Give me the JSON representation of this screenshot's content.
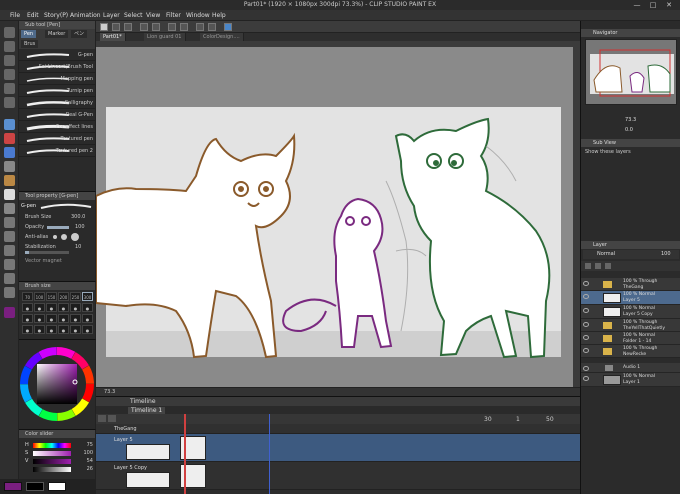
{
  "window": {
    "title": "Part01* (1920 × 1080px 300dpi 73.3%) - CLIP STUDIO PAINT EX",
    "controls": [
      "—",
      "□",
      "✕"
    ]
  },
  "menu": [
    "File",
    "Edit",
    "Story(P)",
    "Animation",
    "Layer",
    "Select",
    "View",
    "Filter",
    "Window",
    "Help"
  ],
  "tabs": [
    "Part01*",
    "Lion guard 01",
    "ColorDesign...."
  ],
  "sub_tool": {
    "title": "Sub tool [Pen]",
    "tabs": [
      "Pen",
      "Marker",
      "ペン"
    ],
    "group": "Brus",
    "brushes": [
      "G-pen",
      "Sai Lineart(Brush Tool",
      "Mapping pen",
      "Turnip pen",
      "Calligraphy",
      "Real G-Pen",
      "For effect lines",
      "Textured pen",
      "Textured pen 2"
    ]
  },
  "tool_property": {
    "title": "Tool property [G-pen]",
    "tool": "G-pen",
    "brush_size_label": "Brush Size",
    "brush_size_value": "300.0",
    "opacity_label": "Opacity",
    "opacity_value": "100",
    "anti_alias_label": "Anti-alias",
    "stabilization_label": "Stabilization",
    "stabilization_value": "10",
    "vector_magnet_label": "Vector magnet"
  },
  "brush_size_panel": {
    "title": "Brush size",
    "sizes": [
      "70",
      "100",
      "150",
      "200",
      "250",
      "300"
    ]
  },
  "color_slider": {
    "title": "Color slider",
    "rows": [
      {
        "label": "H",
        "value": "75"
      },
      {
        "label": "S",
        "value": "100"
      },
      {
        "label": "V",
        "value": "54"
      },
      {
        "label": "",
        "value": "26"
      }
    ]
  },
  "status": {
    "zoom": "73.3"
  },
  "timeline": {
    "title": "Timeline",
    "tab": "Timeline 1",
    "frame_label": "30",
    "fps": "1",
    "total": "50",
    "rows": [
      "TheGang",
      "Layer 5",
      "Layer 5 Copy"
    ]
  },
  "navigator": {
    "title": "Navigator",
    "zoom": "73.3",
    "angle": "0.0"
  },
  "sub_view": {
    "title": "Sub View",
    "label": "Show these layers"
  },
  "layers": {
    "title": "Layer",
    "blend": "Normal",
    "opacity": "100",
    "items": [
      {
        "l1": "100 % Through",
        "l2": "TheGang",
        "kind": "folder"
      },
      {
        "l1": "100 % Normal",
        "l2": "Layer 5",
        "kind": "layer",
        "selected": true
      },
      {
        "l1": "100 % Normal",
        "l2": "Layer 5 Copy",
        "kind": "layer"
      },
      {
        "l1": "100 % Through",
        "l2": "TheYellThatQuietly",
        "kind": "folder"
      },
      {
        "l1": "100 % Normal",
        "l2": "Folder 1 - 14",
        "kind": "folder"
      },
      {
        "l1": "100 % Through",
        "l2": "NewRecke",
        "kind": "folder"
      },
      {
        "l1": "Audio 1",
        "l2": "",
        "kind": "audio"
      },
      {
        "l1": "100 % Normal",
        "l2": "Layer 1",
        "kind": "layer"
      }
    ]
  },
  "colors": {
    "brown_line": "#8a5a2b",
    "purple_line": "#7a2a80",
    "green_line": "#2e6b3a",
    "accent": "#4d6a8e"
  }
}
